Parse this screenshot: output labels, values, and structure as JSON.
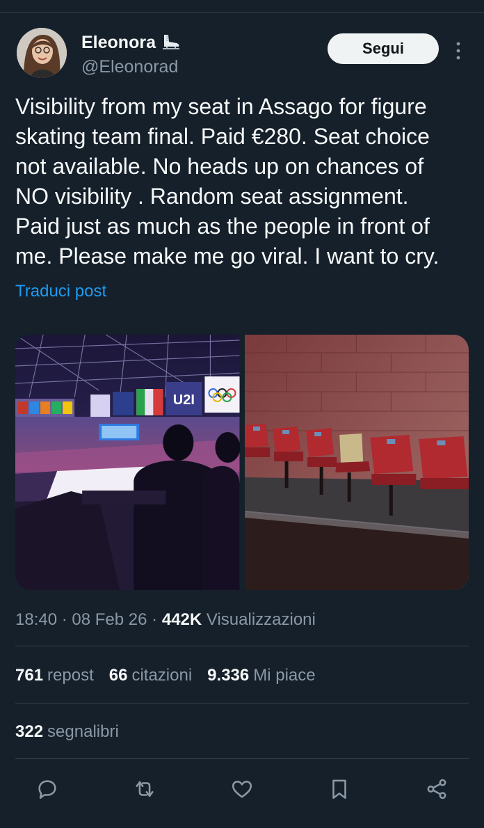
{
  "author": {
    "display_name": "Eleonora",
    "name_emoji": "ice-skate-emoji",
    "handle": "@Eleonorad"
  },
  "follow_label": "Segui",
  "tweet": {
    "lines": [
      "Visibility from my seat in Assago for figure",
      "skating team final. Paid €280. Seat choice",
      "not available. No heads up on chances of",
      "NO visibility . Random seat assignment.",
      "Paid just as much as the people in front of",
      "me. Please make me go viral. I want to cry."
    ]
  },
  "translate_label": "Traduci post",
  "media": {
    "photo1": {
      "description_icon": "arena-view-photo",
      "banner_text": "U2I"
    },
    "photo2": {
      "description_icon": "red-seats-photo"
    }
  },
  "meta": {
    "time": "18:40",
    "date": "08 Feb 26",
    "separator": "·",
    "views_count": "442K",
    "views_label": "Visualizzazioni"
  },
  "stats": [
    {
      "count": "761",
      "label": "repost"
    },
    {
      "count": "66",
      "label": "citazioni"
    },
    {
      "count": "9.336",
      "label": "Mi piace"
    }
  ],
  "bookmarks": {
    "count": "322",
    "label": "segnalibri"
  },
  "actions": [
    "reply-icon",
    "repost-icon",
    "like-icon",
    "bookmark-icon",
    "share-icon"
  ],
  "colors": {
    "background": "#15202b",
    "text": "#f7f9f9",
    "secondary": "#8b98a5",
    "link": "#1d9bf0",
    "divider": "#38444d"
  }
}
